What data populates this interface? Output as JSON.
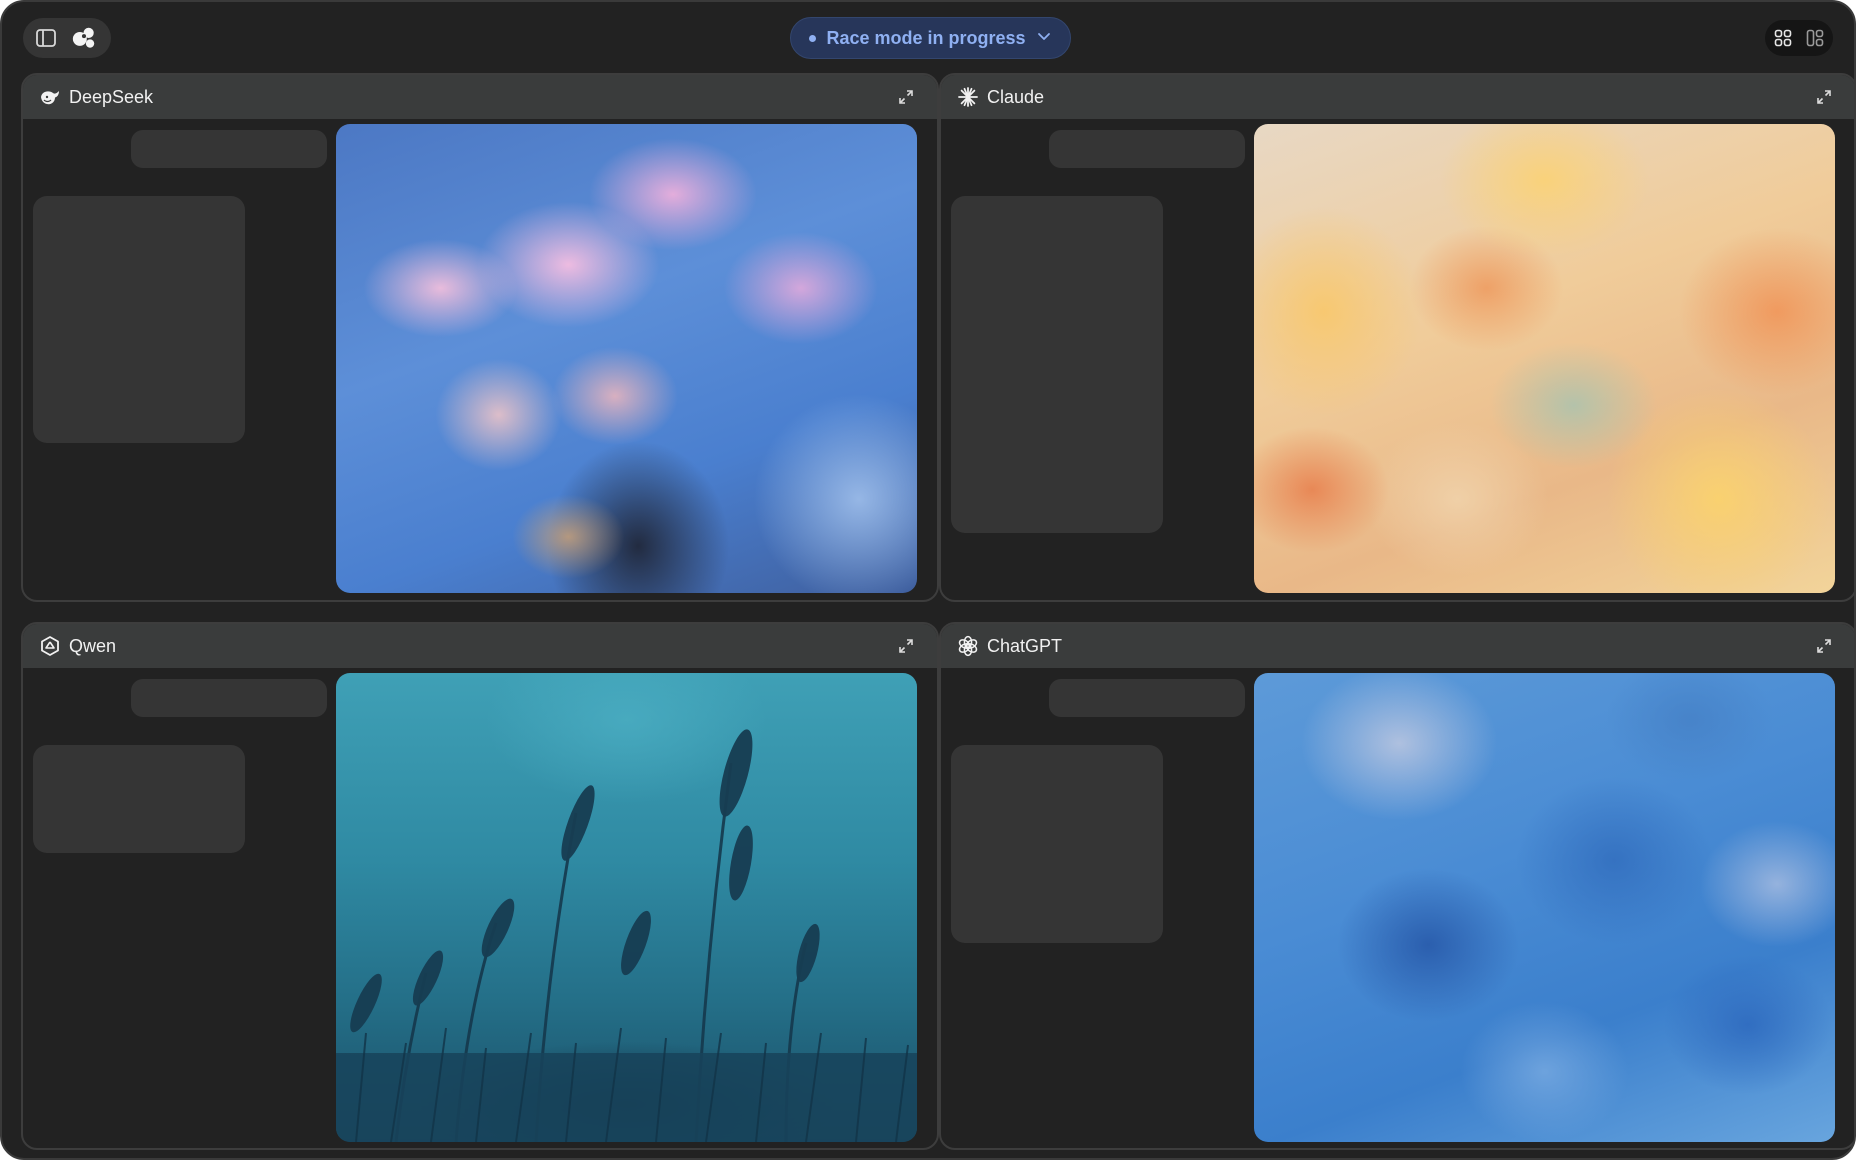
{
  "topbar": {
    "race_status": "Race mode in progress"
  },
  "panels": [
    {
      "model": "DeepSeek",
      "icon": "deepseek-whale-icon"
    },
    {
      "model": "Claude",
      "icon": "claude-sparkle-icon"
    },
    {
      "model": "Qwen",
      "icon": "qwen-logo-icon"
    },
    {
      "model": "ChatGPT",
      "icon": "openai-logo-icon"
    }
  ],
  "colors": {
    "window_bg": "#222222",
    "panel_header": "#3a3c3c",
    "skeleton": "#353535",
    "accent": "#8fb0f2",
    "accent_bg": "#27365a"
  }
}
